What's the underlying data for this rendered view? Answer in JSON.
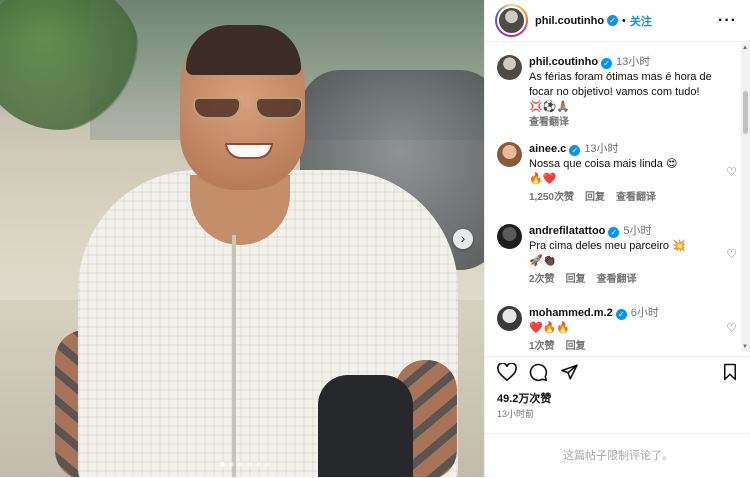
{
  "header": {
    "username": "phil.coutinho",
    "verified_icon": "verified-badge-icon",
    "separator": "•",
    "follow_label": "关注",
    "more_label": "···"
  },
  "caption": {
    "username": "phil.coutinho",
    "time": "13小时",
    "text": "As férias foram ótimas mas é hora de focar no objetivo! vamos com tudo!",
    "emoji": "💢⚽🙏🏽",
    "translate": "查看翻译"
  },
  "comments": [
    {
      "username": "ainee.c",
      "time": "13小时",
      "text": "Nossa que coisa mais linda 😍",
      "emoji": "🔥❤️",
      "likes": "1,250次赞",
      "reply": "回复",
      "translate": "查看翻译"
    },
    {
      "username": "andrefilatattoo",
      "time": "5小时",
      "text": "Pra cima deles meu parceiro 💥",
      "emoji": "🚀👏🏿",
      "likes": "2次赞",
      "reply": "回复",
      "translate": "查看翻译"
    },
    {
      "username": "mohammed.m.2",
      "time": "6小时",
      "text": "❤️🔥🔥",
      "emoji": "",
      "likes": "1次赞",
      "reply": "回复",
      "translate": ""
    }
  ],
  "actions": {
    "like_icon": "heart-outline-icon",
    "comment_icon": "comment-icon",
    "share_icon": "paper-plane-icon",
    "save_icon": "bookmark-icon"
  },
  "likes_count": "49.2万次赞",
  "posted_ago": "13小时前",
  "comments_limited": "这篇帖子限制评论了。",
  "carousel": {
    "next_label": "›",
    "slide_count": 6,
    "current_slide": 1
  }
}
